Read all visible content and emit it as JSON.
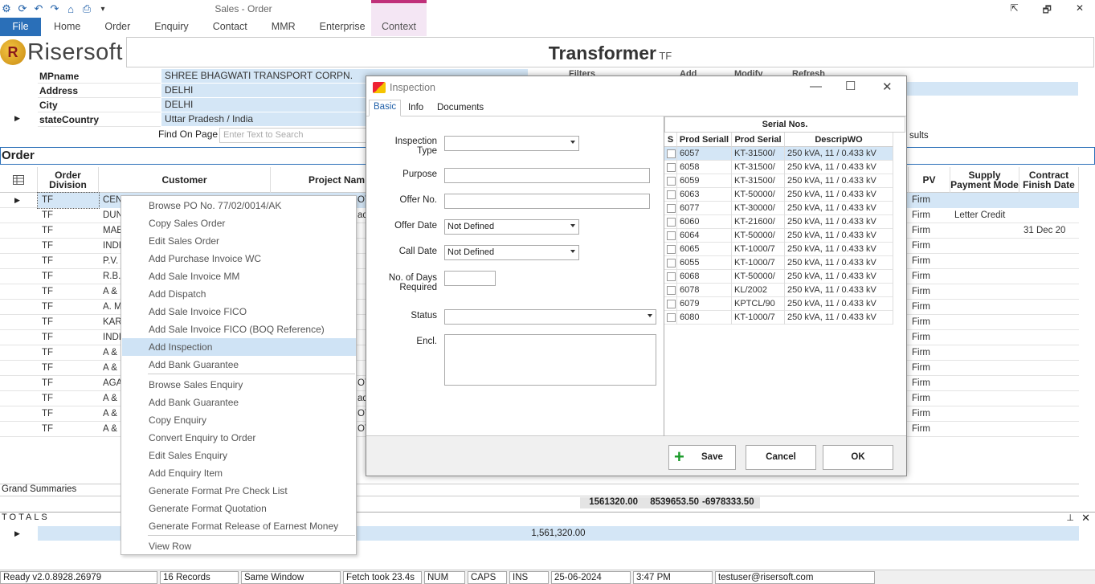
{
  "window": {
    "title": "Sales - Order",
    "controls": [
      "⇱",
      "🗗",
      "✕"
    ]
  },
  "ribbon": {
    "tabs": [
      "File",
      "Home",
      "Order",
      "Enquiry",
      "Contact",
      "MMR",
      "Enterprise"
    ],
    "context_tab": "Context"
  },
  "header": {
    "logo_text": "Risersoft",
    "title": "Transformer",
    "subtitle": "TF"
  },
  "info": {
    "rows": [
      {
        "label": "MPname",
        "value": "SHREE BHAGWATI TRANSPORT CORPN."
      },
      {
        "label": "Address",
        "value": "DELHI"
      },
      {
        "label": "City",
        "value": "DELHI"
      },
      {
        "label": "stateCountry",
        "value": "Uttar Pradesh / India"
      }
    ],
    "hidden_headers": [
      "Filters",
      "Add",
      "Modify",
      "Refresh"
    ],
    "results_fragment": "sults"
  },
  "find": {
    "label": "Find On Page",
    "placeholder": "Enter Text to Search"
  },
  "order": {
    "title": "Order",
    "columns": {
      "division": "Order Division",
      "customer": "Customer",
      "project": "Project Nam",
      "pv": "PV",
      "supply": "Supply Payment Mode",
      "contract": "Contract Finish Date"
    },
    "rows": [
      {
        "div": "TF",
        "cust": "CEN",
        "proj": "OT",
        "pv": "Firm",
        "supply": "",
        "finish": ""
      },
      {
        "div": "TF",
        "cust": "DUN",
        "proj": "ad",
        "pv": "Firm",
        "supply": "Letter Credit",
        "finish": ""
      },
      {
        "div": "TF",
        "cust": "MAE",
        "proj": "",
        "pv": "Firm",
        "supply": "",
        "finish": "31 Dec 20"
      },
      {
        "div": "TF",
        "cust": "INDI",
        "proj": "",
        "pv": "Firm",
        "supply": "",
        "finish": ""
      },
      {
        "div": "TF",
        "cust": "P.V.",
        "proj": "",
        "pv": "Firm",
        "supply": "",
        "finish": ""
      },
      {
        "div": "TF",
        "cust": "R.B.",
        "proj": "",
        "pv": "Firm",
        "supply": "",
        "finish": ""
      },
      {
        "div": "TF",
        "cust": "A & I",
        "proj": "",
        "pv": "Firm",
        "supply": "",
        "finish": ""
      },
      {
        "div": "TF",
        "cust": "A. M",
        "proj": "",
        "pv": "Firm",
        "supply": "",
        "finish": ""
      },
      {
        "div": "TF",
        "cust": "KAR",
        "proj": "",
        "pv": "Firm",
        "supply": "",
        "finish": ""
      },
      {
        "div": "TF",
        "cust": "INDI",
        "proj": "",
        "pv": "Firm",
        "supply": "",
        "finish": ""
      },
      {
        "div": "TF",
        "cust": "A & I",
        "proj": "",
        "pv": "Firm",
        "supply": "",
        "finish": ""
      },
      {
        "div": "TF",
        "cust": "A & I",
        "proj": "",
        "pv": "Firm",
        "supply": "",
        "finish": ""
      },
      {
        "div": "TF",
        "cust": "AGA",
        "proj": "OT",
        "pv": "Firm",
        "supply": "",
        "finish": ""
      },
      {
        "div": "TF",
        "cust": "A & I",
        "proj": "ad",
        "pv": "Firm",
        "supply": "",
        "finish": ""
      },
      {
        "div": "TF",
        "cust": "A & I",
        "proj": "OT",
        "pv": "Firm",
        "supply": "",
        "finish": ""
      },
      {
        "div": "TF",
        "cust": "A & I",
        "proj": "OT",
        "pv": "Firm",
        "supply": "",
        "finish": ""
      }
    ]
  },
  "summaries": {
    "label": "Grand Summaries",
    "values": [
      "1561320.00",
      "8539653.50",
      "-6978333.50"
    ]
  },
  "totals": {
    "label": "TOTALS",
    "value": "1,561,320.00"
  },
  "context_menu": {
    "items": [
      "Browse  PO No. 77/02/0014/AK",
      "Copy Sales Order",
      "Edit Sales Order",
      "Add Purchase Invoice WC",
      "Add Sale Invoice MM",
      "Add Dispatch",
      "Add Sale Invoice FICO",
      "Add Sale Invoice FICO (BOQ Reference)",
      "Add Inspection",
      "Add Bank Guarantee",
      "Browse  Sales Enquiry",
      "Add Bank Guarantee",
      "Copy Enquiry",
      "Convert Enquiry to Order",
      "Edit Sales Enquiry",
      "Add Enquiry Item",
      "Generate Format Pre Check List",
      "Generate Format Quotation",
      "Generate Format Release of Earnest Money",
      "View Row"
    ]
  },
  "dialog": {
    "title": "Inspection",
    "tabs": [
      "Basic",
      "Info",
      "Documents"
    ],
    "fields": {
      "inspection_type": "Inspection Type",
      "purpose": "Purpose",
      "offer_no": "Offer No.",
      "offer_date": "Offer Date",
      "offer_date_value": "Not Defined",
      "call_date": "Call Date",
      "call_date_value": "Not Defined",
      "days_required": "No. of Days Required",
      "status": "Status",
      "encl": "Encl."
    },
    "serial": {
      "title": "Serial Nos.",
      "columns": [
        "S",
        "Prod Seriall",
        "Prod Serial",
        "DescripWO"
      ],
      "rows": [
        [
          "6057",
          "KT-31500/",
          "250 kVA, 11 / 0.433 kV"
        ],
        [
          "6058",
          "KT-31500/",
          "250 kVA, 11 / 0.433 kV"
        ],
        [
          "6059",
          "KT-31500/",
          "250 kVA, 11 / 0.433 kV"
        ],
        [
          "6063",
          "KT-50000/",
          "250 kVA, 11 / 0.433 kV"
        ],
        [
          "6077",
          "KT-30000/",
          "250 kVA, 11 / 0.433 kV"
        ],
        [
          "6060",
          "KT-21600/",
          "250 kVA, 11 / 0.433 kV"
        ],
        [
          "6064",
          "KT-50000/",
          "250 kVA, 11 / 0.433 kV"
        ],
        [
          "6065",
          "KT-1000/7",
          "250 kVA, 11 / 0.433 kV"
        ],
        [
          "6055",
          "KT-1000/7",
          "250 kVA, 11 / 0.433 kV"
        ],
        [
          "6068",
          "KT-50000/",
          "250 kVA, 11 / 0.433 kV"
        ],
        [
          "6078",
          "KL/2002",
          "250 kVA, 11 / 0.433 kV"
        ],
        [
          "6079",
          "KPTCL/90",
          "250 kVA, 11 / 0.433 kV"
        ],
        [
          "6080",
          "KT-1000/7",
          "250 kVA, 11 / 0.433 kV"
        ]
      ]
    },
    "buttons": {
      "save": "Save",
      "cancel": "Cancel",
      "ok": "OK"
    }
  },
  "statusbar": {
    "items": [
      "Ready v2.0.8928.26979",
      "16 Records",
      "Same Window",
      "Fetch took 23.4s",
      "NUM",
      "CAPS",
      "INS",
      "25-06-2024",
      "3:47 PM",
      "testuser@risersoft.com"
    ]
  },
  "colors": {
    "accent": "#2a6fb8",
    "selection": "#d4e6f6",
    "context": "#f4e6f4"
  }
}
